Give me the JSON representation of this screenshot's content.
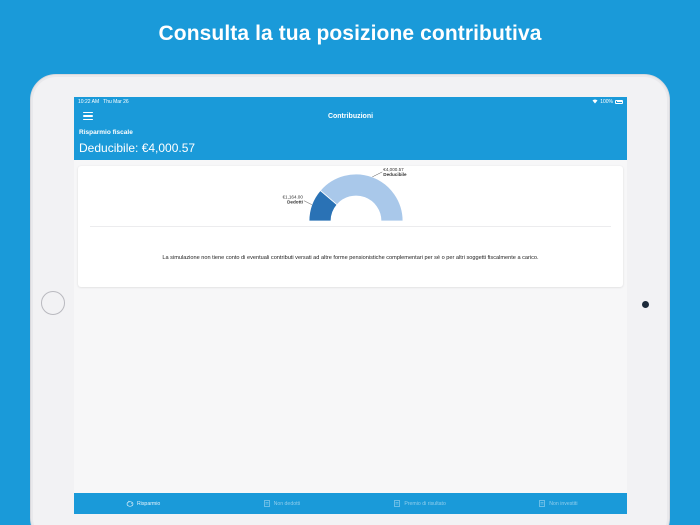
{
  "headline": "Consulta la tua posizione contributiva",
  "status": {
    "time": "10:22 AM",
    "date": "Thu Mar 26",
    "battery": "100%"
  },
  "nav": {
    "title": "Contribuzioni"
  },
  "header": {
    "label": "Risparmio fiscale",
    "deductible": "Deducibile: €4,000.57"
  },
  "chart_data": {
    "type": "pie",
    "subtype": "half-donut",
    "slices": [
      {
        "label": "Dedotti",
        "value": 1164.0,
        "value_label": "€1,164.00",
        "color": "#2a72b5"
      },
      {
        "label": "Deducibile",
        "value": 4000.57,
        "value_label": "€4,000.57",
        "color": "#a9c8ea"
      }
    ]
  },
  "note": "La simulazione non tiene conto di eventuali contributi versati ad altre forme pensionistiche complementari per sé o per altri soggetti fiscalmente a carico.",
  "tabs": [
    {
      "label": "Risparmio",
      "icon": "piggy-bank-icon",
      "active": true
    },
    {
      "label": "Non dedotti",
      "icon": "document-icon",
      "active": false
    },
    {
      "label": "Premio di risultato",
      "icon": "document-icon",
      "active": false
    },
    {
      "label": "Non investiti",
      "icon": "document-icon",
      "active": false
    }
  ]
}
